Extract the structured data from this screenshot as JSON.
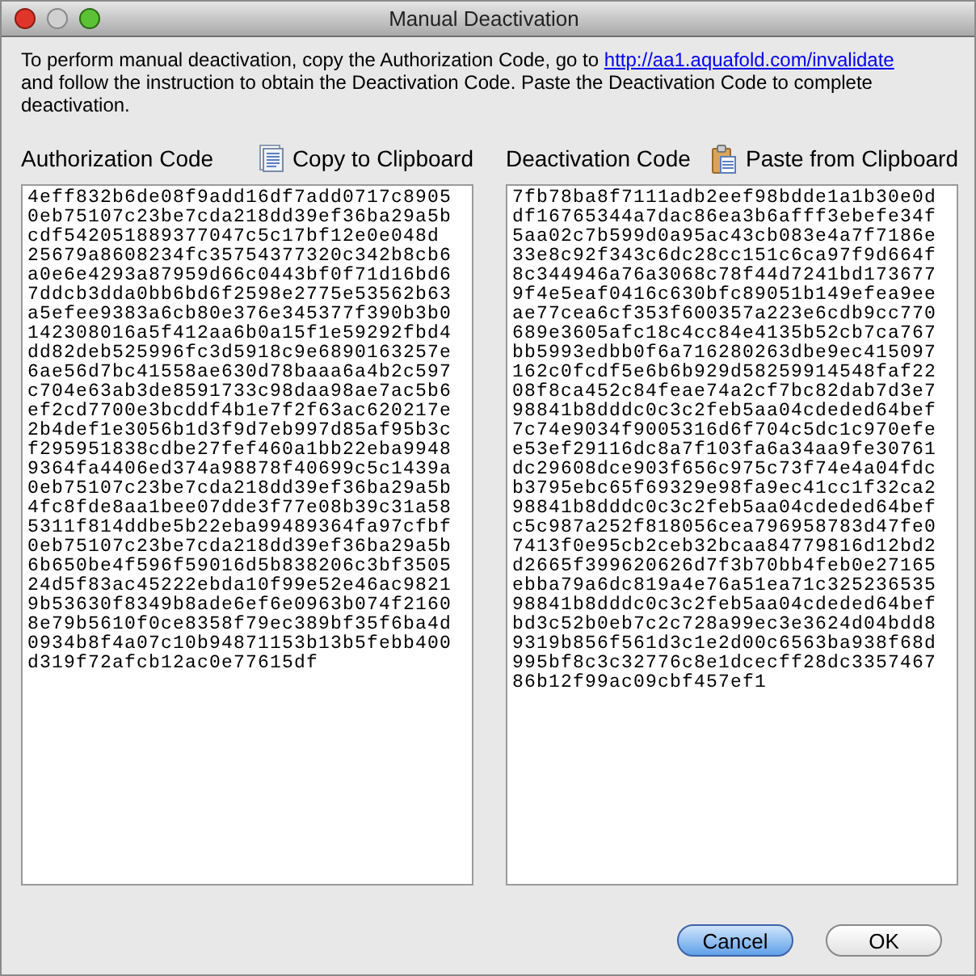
{
  "window": {
    "title": "Manual Deactivation"
  },
  "instructions": {
    "before": "To perform manual deactivation, copy the Authorization Code, go to",
    "link": "http://aa1.aquafold.com/invalidate",
    "after": "and follow the instruction to obtain the Deactivation Code. Paste the Deactivation Code to complete deactivation."
  },
  "authorization": {
    "label": "Authorization Code",
    "button": "Copy to Clipboard",
    "lines": [
      "4eff832b6de08f9add16df7add0717c8905",
      "0eb75107c23be7cda218dd39ef36ba29a5b",
      "cdf542051889377047c5c17bf12e0e048d",
      "25679a8608234fc35754377320c342b8cb6",
      "a0e6e4293a87959d66c0443bf0f71d16bd6",
      "7ddcb3dda0bb6bd6f2598e2775e53562b63",
      "a5efee9383a6cb80e376e345377f390b3b0",
      "142308016a5f412aa6b0a15f1e59292fbd4",
      "dd82deb525996fc3d5918c9e6890163257e",
      "6ae56d7bc41558ae630d78baaa6a4b2c597",
      "c704e63ab3de8591733c98daa98ae7ac5b6",
      "ef2cd7700e3bcddf4b1e7f2f63ac620217e",
      "2b4def1e3056b1d3f9d7eb997d85af95b3c",
      "f295951838cdbe27fef460a1bb22eba9948",
      "9364fa4406ed374a98878f40699c5c1439a",
      "0eb75107c23be7cda218dd39ef36ba29a5b",
      "4fc8fde8aa1bee07dde3f77e08b39c31a58",
      "5311f814ddbe5b22eba99489364fa97cfbf",
      "0eb75107c23be7cda218dd39ef36ba29a5b",
      "6b650be4f596f59016d5b838206c3bf3505",
      "24d5f83ac45222ebda10f99e52e46ac9821",
      "9b53630f8349b8ade6ef6e0963b074f2160",
      "8e79b5610f0ce8358f79ec389bf35f6ba4d",
      "0934b8f4a07c10b94871153b13b5febb400",
      "d319f72afcb12ac0e77615df"
    ]
  },
  "deactivation": {
    "label": "Deactivation Code",
    "button": "Paste from Clipboard",
    "lines": [
      "7fb78ba8f7111adb2eef98bdde1a1b30e0d",
      "df16765344a7dac86ea3b6afff3ebefe34f",
      "5aa02c7b599d0a95ac43cb083e4a7f7186e",
      "33e8c92f343c6dc28cc151c6ca97f9d664f",
      "8c344946a76a3068c78f44d7241bd173677",
      "9f4e5eaf0416c630bfc89051b149efea9ee",
      "ae77cea6cf353f600357a223e6cdb9cc770",
      "689e3605afc18c4cc84e4135b52cb7ca767",
      "bb5993edbb0f6a716280263dbe9ec415097",
      "162c0fcdf5e6b6b929d58259914548faf22",
      "08f8ca452c84feae74a2cf7bc82dab7d3e7",
      "98841b8dddc0c3c2feb5aa04cdeded64bef",
      "7c74e9034f9005316d6f704c5dc1c970efe",
      "e53ef29116dc8a7f103fa6a34aa9fe30761",
      "dc29608dce903f656c975c73f74e4a04fdc",
      "b3795ebc65f69329e98fa9ec41cc1f32ca2",
      "98841b8dddc0c3c2feb5aa04cdeded64bef",
      "c5c987a252f818056cea796958783d47fe0",
      "7413f0e95cb2ceb32bcaa84779816d12bd2",
      "d2665f399620626d7f3b70bb4feb0e27165",
      "ebba79a6dc819a4e76a51ea71c325236535",
      "98841b8dddc0c3c2feb5aa04cdeded64bef",
      "bd3c52b0eb7c2c728a99ec3e3624d04bdd8",
      "9319b856f561d3c1e2d00c6563ba938f68d",
      "995bf8c3c32776c8e1dcecff28dc3357467",
      "86b12f99ac09cbf457ef1"
    ]
  },
  "buttons": [
    {
      "label": "Cancel",
      "default": true
    },
    {
      "label": "OK",
      "default": false
    }
  ]
}
